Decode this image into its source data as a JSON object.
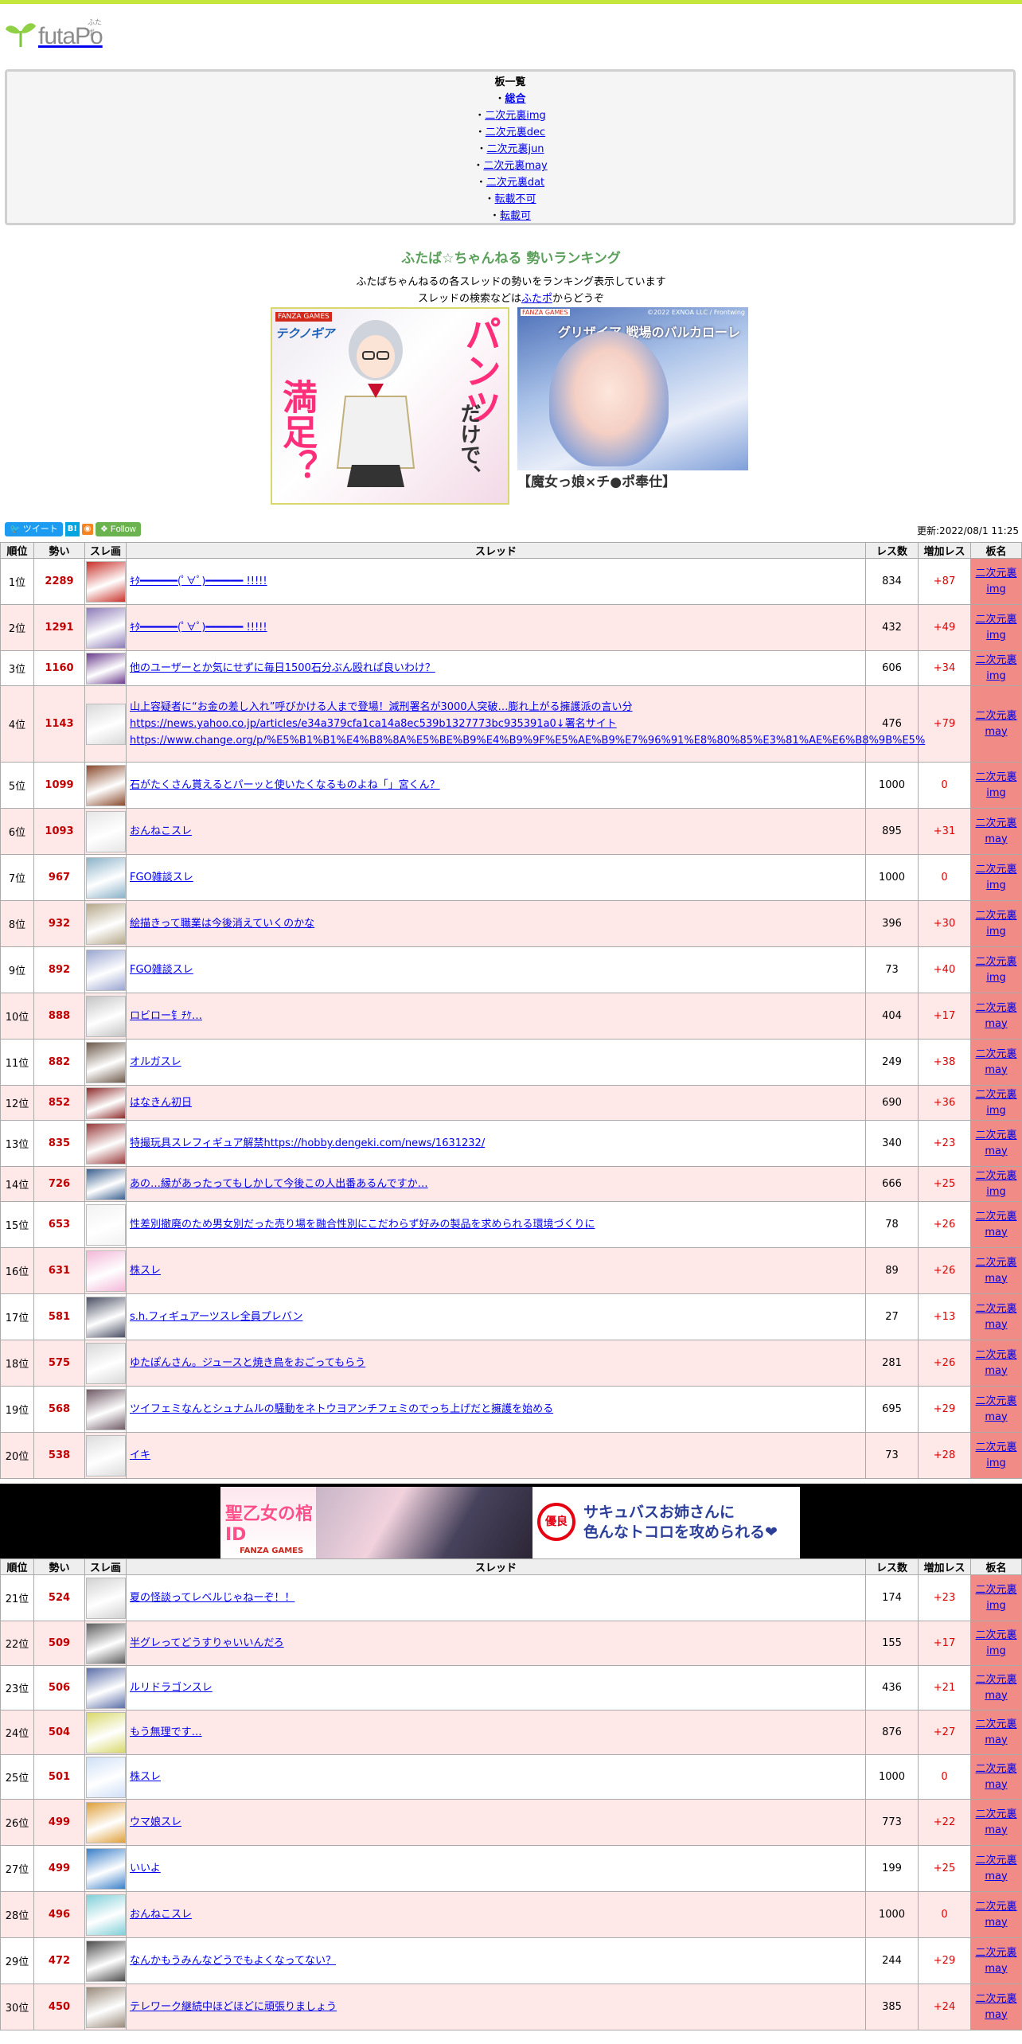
{
  "site": {
    "logo_text": "futaPo",
    "logo_sup": "ふたポ"
  },
  "boards": {
    "title": "板一覧",
    "items": [
      "総合",
      "二次元裏img",
      "二次元裏dec",
      "二次元裏jun",
      "二次元裏may",
      "二次元裏dat",
      "転載不可",
      "転載可"
    ]
  },
  "ranking": {
    "title": "ふたば☆ちゃんねる 勢いランキング",
    "desc1": "ふたばちゃんねるの各スレッドの勢いをランキング表示しています",
    "desc2_pre": "スレッドの検索などは",
    "desc2_link": "ふたポ",
    "desc2_post": "からどうぞ"
  },
  "ads": {
    "ad1": {
      "brand": "FANZA GAMES",
      "game": "テクノギア",
      "pants": "パンツ",
      "dake": "だけで、",
      "manzoku": "満足？"
    },
    "ad2": {
      "brand": "FANZA GAMES",
      "copy": "©2022 EXNOA LLC / Frontwing",
      "logo": "グリザイア 戦場のバルカローレ",
      "caption": "【魔女っ娘×チ●ポ奉仕】"
    },
    "ad3": {
      "title": "聖乙女の棺ID",
      "brand": "FANZA GAMES",
      "badge": "優良",
      "line1": "サキュバスお姉さんに",
      "line2": "色んなトコロを攻められる❤"
    }
  },
  "share": {
    "tweet": "ツイート",
    "hatena": "B!",
    "follow": "Follow"
  },
  "updated": "更新:2022/08/1 11:25",
  "table_headers": {
    "rank": "順位",
    "ikioi": "勢い",
    "thumb": "スレ画",
    "thread": "スレッド",
    "res": "レス数",
    "inc": "増加レス",
    "board": "板名"
  },
  "rows1": [
    {
      "rank": "1位",
      "ikioi": "2289",
      "title": "ｷﾀ━━━━━━(ﾟ∀ﾟ)━━━━━━ !!!!!",
      "res": "834",
      "inc": "+87",
      "board1": "二次元裏",
      "board2": "img",
      "color": "#c9322a"
    },
    {
      "rank": "2位",
      "ikioi": "1291",
      "title": "ｷﾀ━━━━━━(ﾟ∀ﾟ)━━━━━━ !!!!!",
      "res": "432",
      "inc": "+49",
      "board1": "二次元裏",
      "board2": "img",
      "color": "#8d7bb8"
    },
    {
      "rank": "3位",
      "ikioi": "1160",
      "title": "他のユーザーとか気にせずに毎日1500石分ぶん殴れば良いわけ？",
      "res": "606",
      "inc": "+34",
      "board1": "二次元裏",
      "board2": "img",
      "color": "#6b3d8e"
    },
    {
      "rank": "4位",
      "ikioi": "1143",
      "title": "山上容疑者に“お金の差し入れ”呼びかける人まで登場！減刑署名が3000人突破…膨れ上がる擁護派の言い分 https://news.yahoo.co.jp/articles/e34a379cfa1ca14a8ec539b1327773bc935391a0↓署名サイト https://www.change.org/p/%E5%B1%B1%E4%B8%8A%E5%BE%B9%E4%B9%9F%E5%AE%B9%E7%96%91%E8%80%85%E3%81%AE%E6%B8%9B%E5%",
      "res": "476",
      "inc": "+79",
      "board1": "二次元裏",
      "board2": "may",
      "color": "#d9d9d9"
    },
    {
      "rank": "5位",
      "ikioi": "1099",
      "title": "石がたくさん貰えるとパーッと使いたくなるものよね「」宮くん？",
      "res": "1000",
      "inc": "0",
      "board1": "二次元裏",
      "board2": "img",
      "color": "#8a4a2c"
    },
    {
      "rank": "6位",
      "ikioi": "1093",
      "title": "おんねこスレ",
      "res": "895",
      "inc": "+31",
      "board1": "二次元裏",
      "board2": "may",
      "color": "#e6e6e6"
    },
    {
      "rank": "7位",
      "ikioi": "967",
      "title": "FGO雑談スレ",
      "res": "1000",
      "inc": "0",
      "board1": "二次元裏",
      "board2": "img",
      "color": "#8bb3c9"
    },
    {
      "rank": "8位",
      "ikioi": "932",
      "title": "絵描きって職業は今後消えていくのかな",
      "res": "396",
      "inc": "+30",
      "board1": "二次元裏",
      "board2": "img",
      "color": "#b6a88a"
    },
    {
      "rank": "9位",
      "ikioi": "892",
      "title": "FGO雑談スレ",
      "res": "73",
      "inc": "+40",
      "board1": "二次元裏",
      "board2": "img",
      "color": "#9aa6d1"
    },
    {
      "rank": "10位",
      "ikioi": "888",
      "title": "ロビロー钅ﾁｹ…",
      "res": "404",
      "inc": "+17",
      "board1": "二次元裏",
      "board2": "may",
      "color": "#c4c4c4"
    },
    {
      "rank": "11位",
      "ikioi": "882",
      "title": "オルガスレ",
      "res": "249",
      "inc": "+38",
      "board1": "二次元裏",
      "board2": "may",
      "color": "#6d5a4a"
    },
    {
      "rank": "12位",
      "ikioi": "852",
      "title": "はなきん初日",
      "res": "690",
      "inc": "+36",
      "board1": "二次元裏",
      "board2": "img",
      "color": "#8e2a2a"
    },
    {
      "rank": "13位",
      "ikioi": "835",
      "title": "特撮玩具スレフィギュア解禁https://hobby.dengeki.com/news/1631232/",
      "res": "340",
      "inc": "+23",
      "board1": "二次元裏",
      "board2": "may",
      "color": "#9a3b3b"
    },
    {
      "rank": "14位",
      "ikioi": "726",
      "title": "あの…縁があったってもしかして今後この人出番あるんですか…",
      "res": "666",
      "inc": "+25",
      "board1": "二次元裏",
      "board2": "img",
      "color": "#3a5f8f"
    },
    {
      "rank": "15位",
      "ikioi": "653",
      "title": "性差別撤廃のため男女別だった売り場を融合性別にこだわらず好みの製品を求められる環境づくりに",
      "res": "78",
      "inc": "+26",
      "board1": "二次元裏",
      "board2": "may",
      "color": "#f2f2f2"
    },
    {
      "rank": "16位",
      "ikioi": "631",
      "title": "株スレ",
      "res": "89",
      "inc": "+26",
      "board1": "二次元裏",
      "board2": "may",
      "color": "#f3b8d8"
    },
    {
      "rank": "17位",
      "ikioi": "581",
      "title": "s.h.フィギュアーツスレ全員プレバン",
      "res": "27",
      "inc": "+13",
      "board1": "二次元裏",
      "board2": "may",
      "color": "#4a4f63"
    },
    {
      "rank": "18位",
      "ikioi": "575",
      "title": "ゆたぽんさん。ジュースと焼き鳥をおごってもらう",
      "res": "281",
      "inc": "+26",
      "board1": "二次元裏",
      "board2": "may",
      "color": "#d8d8d8"
    },
    {
      "rank": "19位",
      "ikioi": "568",
      "title": "ツイフェミなんとシュナムルの騒動をネトウヨアンチフェミのでっち上げだと擁護を始める",
      "res": "695",
      "inc": "+29",
      "board1": "二次元裏",
      "board2": "may",
      "color": "#6f5a66"
    },
    {
      "rank": "20位",
      "ikioi": "538",
      "title": "イキ",
      "res": "73",
      "inc": "+28",
      "board1": "二次元裏",
      "board2": "img",
      "color": "#dcdcdc"
    }
  ],
  "rows2": [
    {
      "rank": "21位",
      "ikioi": "524",
      "title": "夏の怪談ってレベルじゃねーぞ！！",
      "res": "174",
      "inc": "+23",
      "board1": "二次元裏",
      "board2": "img",
      "color": "#d2d2d2"
    },
    {
      "rank": "22位",
      "ikioi": "509",
      "title": "半グレってどうすりゃいいんだろ",
      "res": "155",
      "inc": "+17",
      "board1": "二次元裏",
      "board2": "img",
      "color": "#5e5e5e"
    },
    {
      "rank": "23位",
      "ikioi": "506",
      "title": "ルリドラゴンスレ",
      "res": "436",
      "inc": "+21",
      "board1": "二次元裏",
      "board2": "may",
      "color": "#5b6ea8"
    },
    {
      "rank": "24位",
      "ikioi": "504",
      "title": "もう無理です…",
      "res": "876",
      "inc": "+27",
      "board1": "二次元裏",
      "board2": "may",
      "color": "#d8d86a"
    },
    {
      "rank": "25位",
      "ikioi": "501",
      "title": "株スレ",
      "res": "1000",
      "inc": "0",
      "board1": "二次元裏",
      "board2": "may",
      "color": "#cfe0f7"
    },
    {
      "rank": "26位",
      "ikioi": "499",
      "title": "ウマ娘スレ",
      "res": "773",
      "inc": "+22",
      "board1": "二次元裏",
      "board2": "may",
      "color": "#e0a03a"
    },
    {
      "rank": "27位",
      "ikioi": "499",
      "title": "いいよ",
      "res": "199",
      "inc": "+25",
      "board1": "二次元裏",
      "board2": "may",
      "color": "#3a7fc9"
    },
    {
      "rank": "28位",
      "ikioi": "496",
      "title": "おんねこスレ",
      "res": "1000",
      "inc": "0",
      "board1": "二次元裏",
      "board2": "may",
      "color": "#7fcfd8"
    },
    {
      "rank": "29位",
      "ikioi": "472",
      "title": "なんかもうみんなどうでもよくなってない？",
      "res": "244",
      "inc": "+29",
      "board1": "二次元裏",
      "board2": "may",
      "color": "#4b4b4b"
    },
    {
      "rank": "30位",
      "ikioi": "450",
      "title": "テレワーク継続中ほどほどに頑張りましょう",
      "res": "385",
      "inc": "+24",
      "board1": "二次元裏",
      "board2": "may",
      "color": "#9a8a7a"
    }
  ]
}
